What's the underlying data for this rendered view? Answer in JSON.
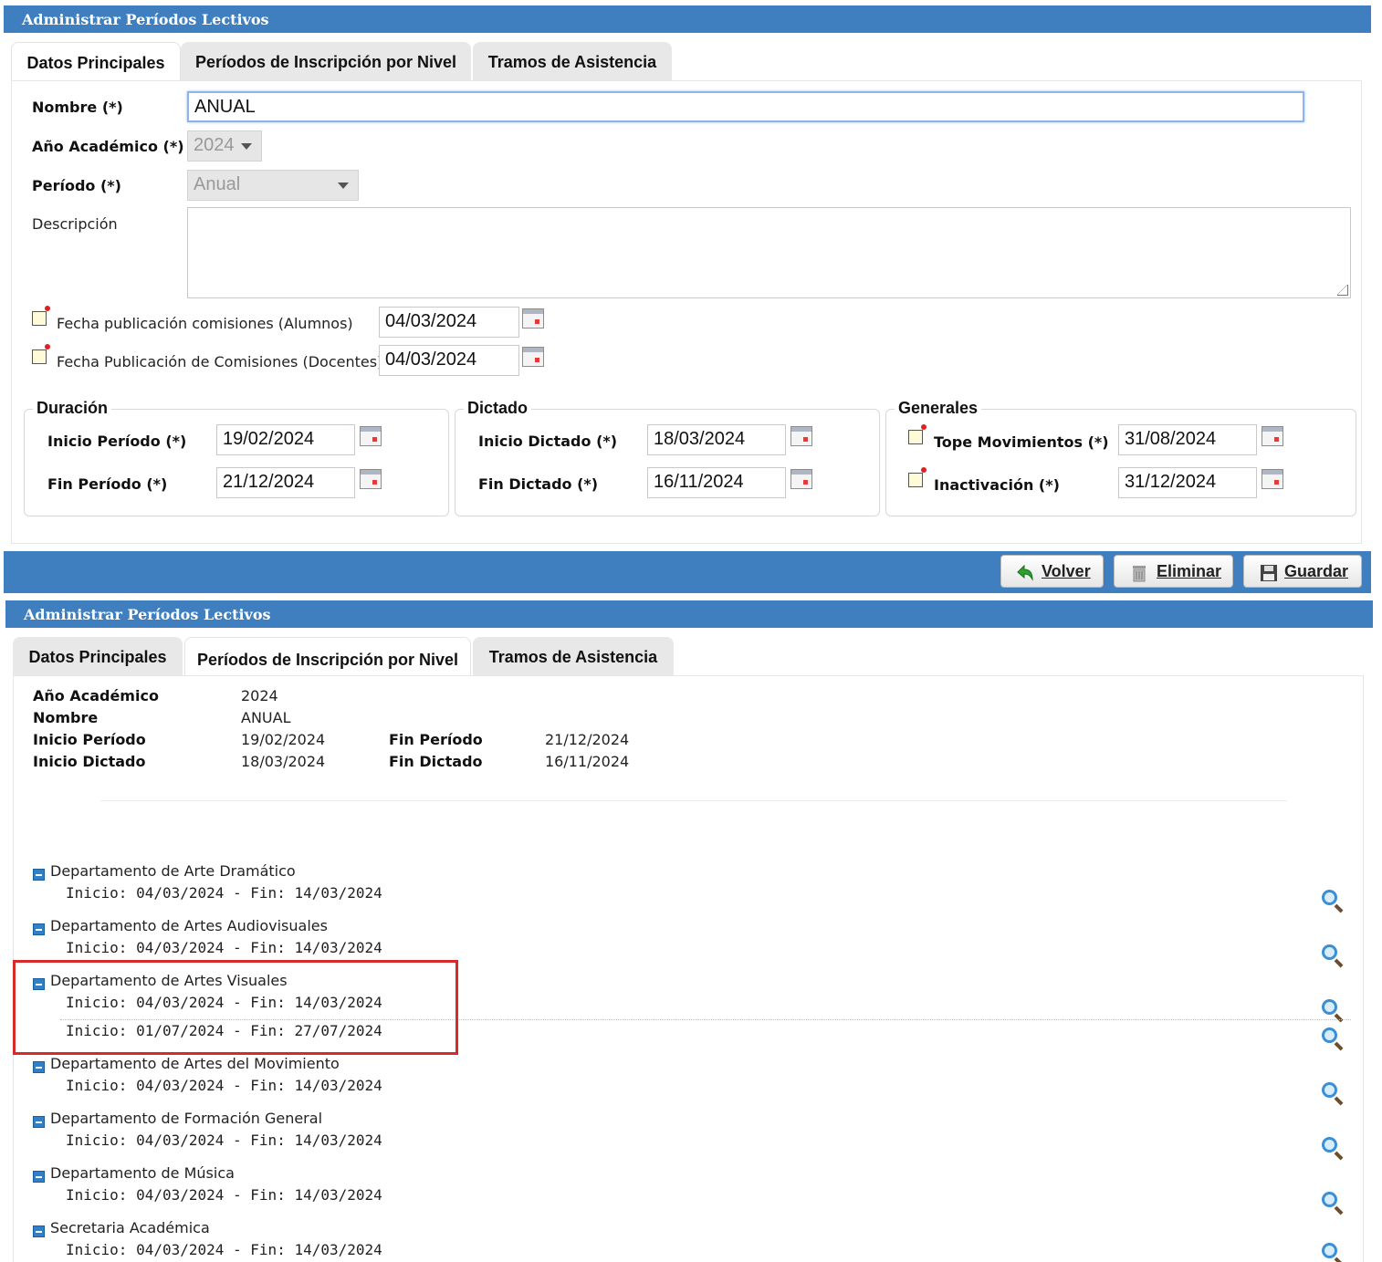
{
  "panel1": {
    "title": "Administrar Períodos Lectivos",
    "tabs": [
      "Datos Principales",
      "Períodos de Inscripción por Nivel",
      "Tramos de Asistencia"
    ],
    "active_tab": "Datos Principales",
    "nombre_label": "Nombre (*)",
    "nombre_value": "ANUAL",
    "anio_label": "Año Académico (*)",
    "anio_value": "2024",
    "periodo_label": "Período (*)",
    "periodo_value": "Anual",
    "descripcion_label": "Descripción",
    "fecha_alumnos_label": "Fecha publicación comisiones (Alumnos)",
    "fecha_alumnos_value": "04/03/2024",
    "fecha_docentes_label": "Fecha Publicación de Comisiones (Docentes)",
    "fecha_docentes_value": "04/03/2024",
    "duracion": {
      "legend": "Duración",
      "inicio_label": "Inicio Período (*)",
      "inicio_value": "19/02/2024",
      "fin_label": "Fin Período (*)",
      "fin_value": "21/12/2024"
    },
    "dictado": {
      "legend": "Dictado",
      "inicio_label": "Inicio Dictado (*)",
      "inicio_value": "18/03/2024",
      "fin_label": "Fin Dictado (*)",
      "fin_value": "16/11/2024"
    },
    "generales": {
      "legend": "Generales",
      "tope_label": "Tope Movimientos (*)",
      "tope_value": "31/08/2024",
      "inact_label": "Inactivación (*)",
      "inact_value": "31/12/2024"
    },
    "buttons": {
      "volver": "Volver",
      "eliminar": "Eliminar",
      "guardar": "Guardar"
    }
  },
  "panel2": {
    "title": "Administrar Períodos Lectivos",
    "tabs": [
      "Datos Principales",
      "Períodos de Inscripción por Nivel",
      "Tramos de Asistencia"
    ],
    "active_tab": "Períodos de Inscripción por Nivel",
    "info": {
      "anio_label": "Año Académico",
      "anio_value": "2024",
      "nombre_label": "Nombre",
      "nombre_value": "ANUAL",
      "inicio_periodo_label": "Inicio Período",
      "inicio_periodo_value": "19/02/2024",
      "fin_periodo_label": "Fin Período",
      "fin_periodo_value": "21/12/2024",
      "inicio_dictado_label": "Inicio Dictado",
      "inicio_dictado_value": "18/03/2024",
      "fin_dictado_label": "Fin Dictado",
      "fin_dictado_value": "16/11/2024"
    },
    "departments": [
      {
        "name": "Departamento de Arte Dramático",
        "ranges": [
          "Inicio: 04/03/2024 - Fin: 14/03/2024"
        ]
      },
      {
        "name": "Departamento de Artes Audiovisuales",
        "ranges": [
          "Inicio: 04/03/2024 - Fin: 14/03/2024"
        ]
      },
      {
        "name": "Departamento de Artes Visuales",
        "ranges": [
          "Inicio: 04/03/2024 - Fin: 14/03/2024",
          "Inicio: 01/07/2024 - Fin: 27/07/2024"
        ],
        "highlighted": true
      },
      {
        "name": "Departamento de Artes del Movimiento",
        "ranges": [
          "Inicio: 04/03/2024 - Fin: 14/03/2024"
        ]
      },
      {
        "name": "Departamento de Formación General",
        "ranges": [
          "Inicio: 04/03/2024 - Fin: 14/03/2024"
        ]
      },
      {
        "name": "Departamento de Música",
        "ranges": [
          "Inicio: 04/03/2024 - Fin: 14/03/2024"
        ]
      },
      {
        "name": "Secretaria Académica",
        "ranges": [
          "Inicio: 04/03/2024 - Fin: 14/03/2024"
        ]
      }
    ],
    "colors": {
      "header": "#3f7fc0",
      "highlight": "#d72a2a"
    }
  }
}
